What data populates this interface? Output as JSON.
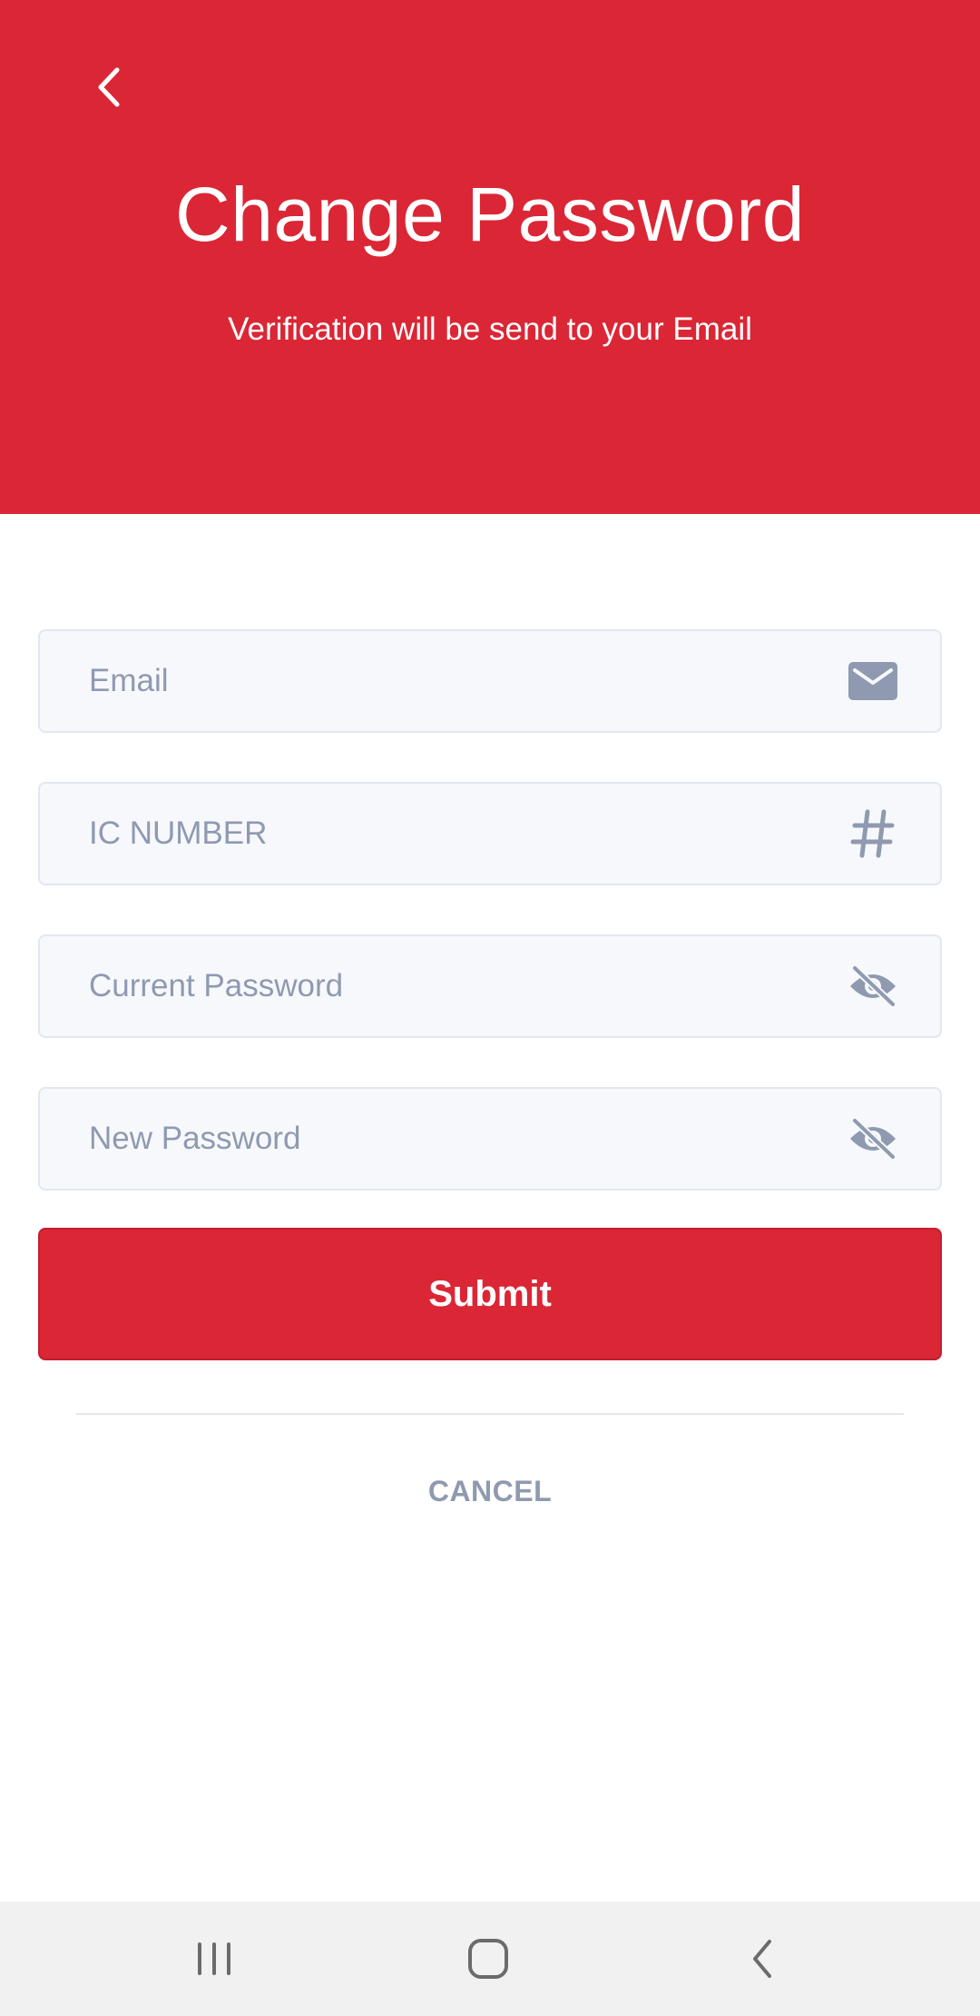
{
  "header": {
    "title": "Change Password",
    "subtitle": "Verification will be send to your Email",
    "background_color": "#db2635"
  },
  "form": {
    "fields": [
      {
        "placeholder": "Email",
        "value": "",
        "icon": "mail-icon"
      },
      {
        "placeholder": "IC NUMBER",
        "value": "",
        "icon": "hash-icon"
      },
      {
        "placeholder": "Current Password",
        "value": "",
        "icon": "eye-off-icon"
      },
      {
        "placeholder": "New Password",
        "value": "",
        "icon": "eye-off-icon"
      }
    ],
    "submit_label": "Submit",
    "cancel_label": "CANCEL"
  },
  "colors": {
    "accent": "#db2635",
    "field_background": "#f6f8fc",
    "field_border": "#e2e7f0",
    "muted_text": "#8f9ab0"
  },
  "system_nav": {
    "buttons": [
      "recent-apps-icon",
      "home-icon",
      "back-icon"
    ]
  }
}
